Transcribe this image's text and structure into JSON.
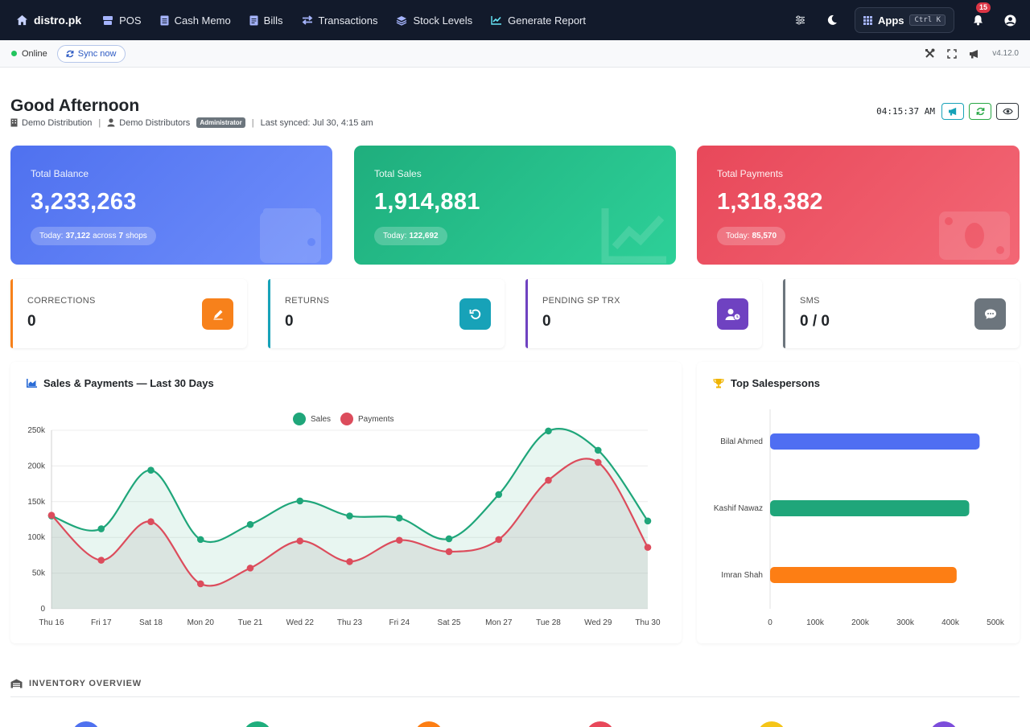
{
  "nav": {
    "brand": "distro.pk",
    "items": [
      {
        "label": "POS",
        "icon": "pos-icon"
      },
      {
        "label": "Cash Memo",
        "icon": "document-icon"
      },
      {
        "label": "Bills",
        "icon": "bill-icon"
      },
      {
        "label": "Transactions",
        "icon": "exchange-icon"
      },
      {
        "label": "Stock Levels",
        "icon": "layers-icon"
      },
      {
        "label": "Generate Report",
        "icon": "chart-line-icon"
      }
    ],
    "apps_label": "Apps",
    "apps_shortcut": "Ctrl K",
    "notification_count": "15"
  },
  "statusbar": {
    "status": "Online",
    "sync_label": "Sync now",
    "version": "v4.12.0"
  },
  "header": {
    "greeting": "Good Afternoon",
    "company": "Demo Distribution",
    "user": "Demo Distributors",
    "role": "Administrator",
    "last_synced": "Last synced: Jul 30, 4:15 am",
    "clock": "04:15:37 AM"
  },
  "stats": {
    "balance": {
      "label": "Total Balance",
      "value": "3,233,263",
      "today_prefix": "Today:",
      "today_value": "37,122",
      "across": "across",
      "shops_count": "7",
      "shops_word": "shops"
    },
    "sales": {
      "label": "Total Sales",
      "value": "1,914,881",
      "today_prefix": "Today:",
      "today_value": "122,692"
    },
    "payments": {
      "label": "Total Payments",
      "value": "1,318,382",
      "today_prefix": "Today:",
      "today_value": "85,570"
    }
  },
  "mini_cards": [
    {
      "label": "CORRECTIONS",
      "value": "0",
      "color": "#f7811b",
      "icon": "pencil-icon"
    },
    {
      "label": "RETURNS",
      "value": "0",
      "color": "#17a2b8",
      "icon": "undo-icon"
    },
    {
      "label": "PENDING SP TRX",
      "value": "0",
      "color": "#6f42c1",
      "icon": "user-clock-icon"
    },
    {
      "label": "SMS",
      "value": "0 / 0",
      "color": "#6c757d",
      "icon": "sms-icon"
    }
  ],
  "sales_chart_title": "Sales & Payments — Last 30 Days",
  "top_sales_title": "Top Salespersons",
  "inventory_title": "INVENTORY OVERVIEW",
  "chart_data": [
    {
      "type": "line",
      "title": "Sales & Payments — Last 30 Days",
      "x": [
        "Thu 16",
        "Fri 17",
        "Sat 18",
        "Mon 20",
        "Tue 21",
        "Wed 22",
        "Thu 23",
        "Fri 24",
        "Sat 25",
        "Mon 27",
        "Tue 28",
        "Wed 29",
        "Thu 30"
      ],
      "series": [
        {
          "name": "Sales",
          "color": "#1fa67a",
          "values": [
            130000,
            112000,
            194000,
            97000,
            118000,
            151000,
            130000,
            127000,
            98000,
            160000,
            249000,
            222000,
            123000
          ]
        },
        {
          "name": "Payments",
          "color": "#dc4c5c",
          "values": [
            131000,
            68000,
            122000,
            35000,
            57000,
            95000,
            66000,
            96000,
            80000,
            97000,
            180000,
            205000,
            86000
          ]
        }
      ],
      "ylim": [
        0,
        250000
      ],
      "yticks": [
        "0",
        "50k",
        "100k",
        "150k",
        "200k",
        "250k"
      ],
      "legend": "top-center",
      "grid": true
    },
    {
      "type": "bar",
      "orientation": "horizontal",
      "title": "Top Salespersons",
      "categories": [
        "Bilal Ahmed",
        "Kashif Nawaz",
        "Imran Shah"
      ],
      "values": [
        465000,
        442000,
        414000
      ],
      "colors": [
        "#4f6ef2",
        "#1fa67a",
        "#fd7e14"
      ],
      "xlim": [
        0,
        500000
      ],
      "xticks": [
        "0",
        "100k",
        "200k",
        "300k",
        "400k",
        "500k"
      ]
    }
  ]
}
